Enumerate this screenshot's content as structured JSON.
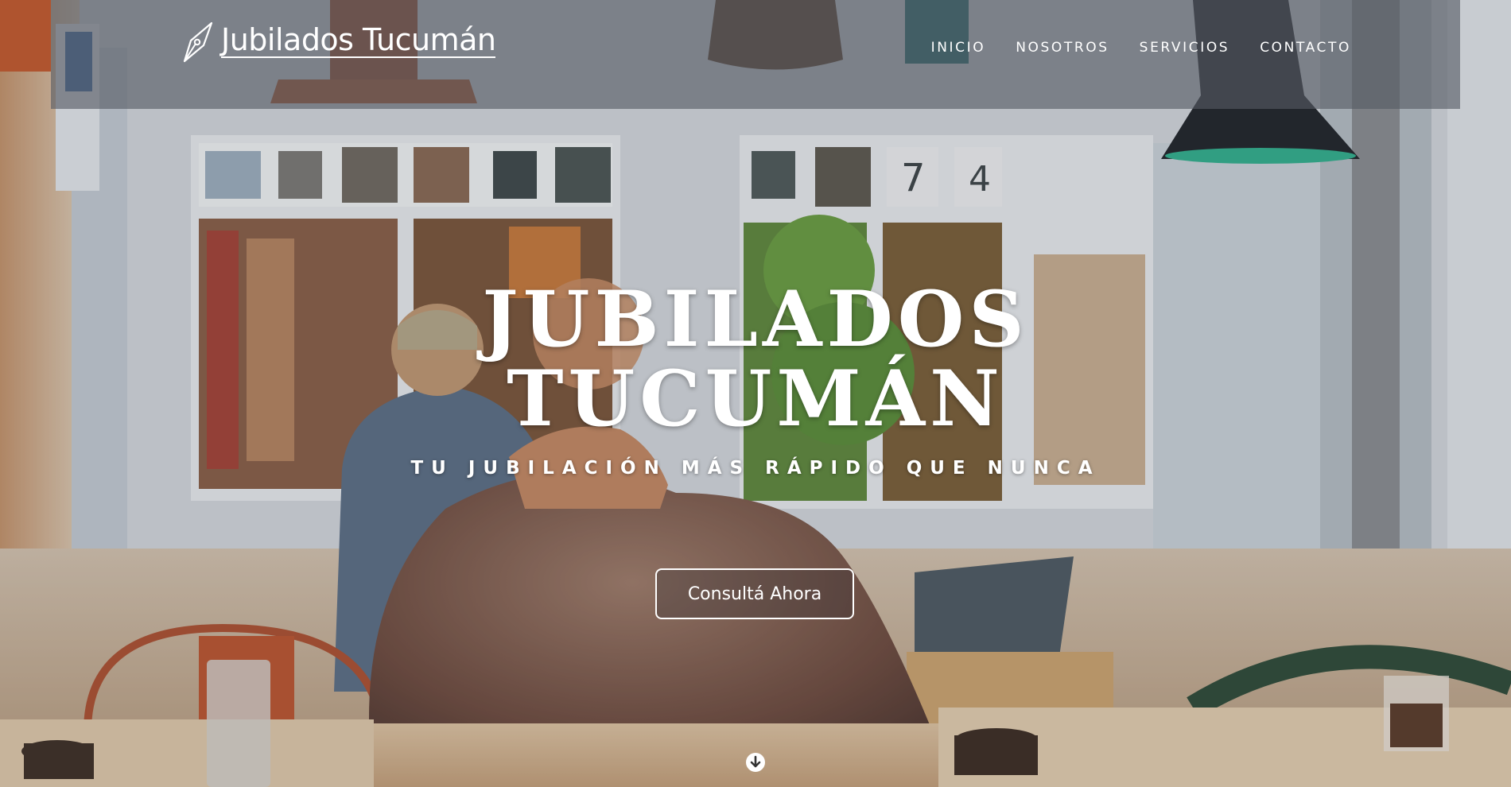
{
  "brand": {
    "name": "Jubilados Tucumán",
    "logo_icon": "quill-pen-icon"
  },
  "nav": {
    "items": [
      "INICIO",
      "NOSOTROS",
      "SERVICIOS",
      "CONTACTO"
    ]
  },
  "hero": {
    "title_line1": "JUBILADOS",
    "title_line2": "TUCUMÁN",
    "subtitle": "TU JUBILACIÓN MÁS RÁPIDO QUE NUNCA",
    "cta_label": "Consultá Ahora",
    "background_scene": "cafe-interior-elderly-man-photo",
    "scroll_icon": "arrow-down-circle-icon"
  },
  "colors": {
    "nav_bg": "#5a5f69",
    "text": "#ffffff",
    "lamp_teal": "#1f8a74"
  }
}
